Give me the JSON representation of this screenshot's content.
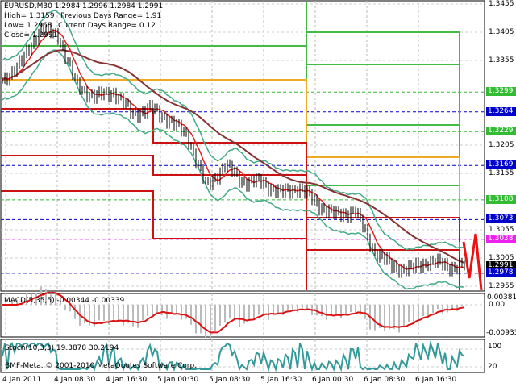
{
  "header": {
    "line1": "EURUSD,M30  1.2984 1.2996 1.2984 1.2991",
    "high": "High= 1.3159",
    "prev_range": "Previous Days Range= 1.91",
    "low": "Low= 1.2968",
    "cur_range": "Current Days Range= 0.12",
    "close": "Close= 1.2991"
  },
  "price_axis": {
    "ticks": [
      "1.3455",
      "1.3405",
      "1.3355",
      "1.3205",
      "1.3155",
      "1.3055",
      "1.3005",
      "1.2955"
    ],
    "tick_values": [
      1.3455,
      1.3405,
      1.3355,
      1.3205,
      1.3155,
      1.3055,
      1.3005,
      1.2955
    ],
    "badges": [
      {
        "text": "1.3299",
        "value": 1.3299,
        "color": "#33bb33"
      },
      {
        "text": "1.3264",
        "value": 1.3264,
        "color": "#0000cc"
      },
      {
        "text": "1.3229",
        "value": 1.3229,
        "color": "#33bb33"
      },
      {
        "text": "1.3169",
        "value": 1.3169,
        "color": "#0000cc"
      },
      {
        "text": "1.3108",
        "value": 1.3108,
        "color": "#33bb33"
      },
      {
        "text": "1.3073",
        "value": 1.3073,
        "color": "#0000cc"
      },
      {
        "text": "1.3038",
        "value": 1.3038,
        "color": "#ee22ee"
      },
      {
        "text": "1.2991",
        "value": 1.2991,
        "color": "#000000"
      },
      {
        "text": "1.2978",
        "value": 1.2978,
        "color": "#0000cc"
      }
    ]
  },
  "price_path": [
    1.332,
    1.335,
    1.341,
    1.34,
    1.331,
    1.329,
    1.33,
    1.326,
    1.327,
    1.325,
    1.322,
    1.313,
    1.317,
    1.314,
    1.314,
    1.312,
    1.313,
    1.31,
    1.308,
    1.309,
    1.302,
    1.299,
    1.2985,
    1.3,
    1.299,
    1.2991
  ],
  "macd": {
    "label": "MACD(5,35,5) -0.00344 -0.00339",
    "max": "0.00381",
    "zero": "0.00",
    "min": "-0.00933"
  },
  "stoch": {
    "label": "Stoch(10,3,3) 19.3878 30.2194",
    "copyright": "BMF-Meta, © 2001-2010 MetaQuotes Software Corp.",
    "top": "100",
    "top2": "80",
    "bottom": "20"
  },
  "time_axis": [
    "4 Jan 2011",
    "4 Jan 08:30",
    "4 Jan 16:30",
    "5 Jan 00:30",
    "5 Jan 08:30",
    "5 Jan 16:30",
    "6 Jan 00:30",
    "6 Jan 08:30",
    "6 Jan 16:30"
  ]
}
